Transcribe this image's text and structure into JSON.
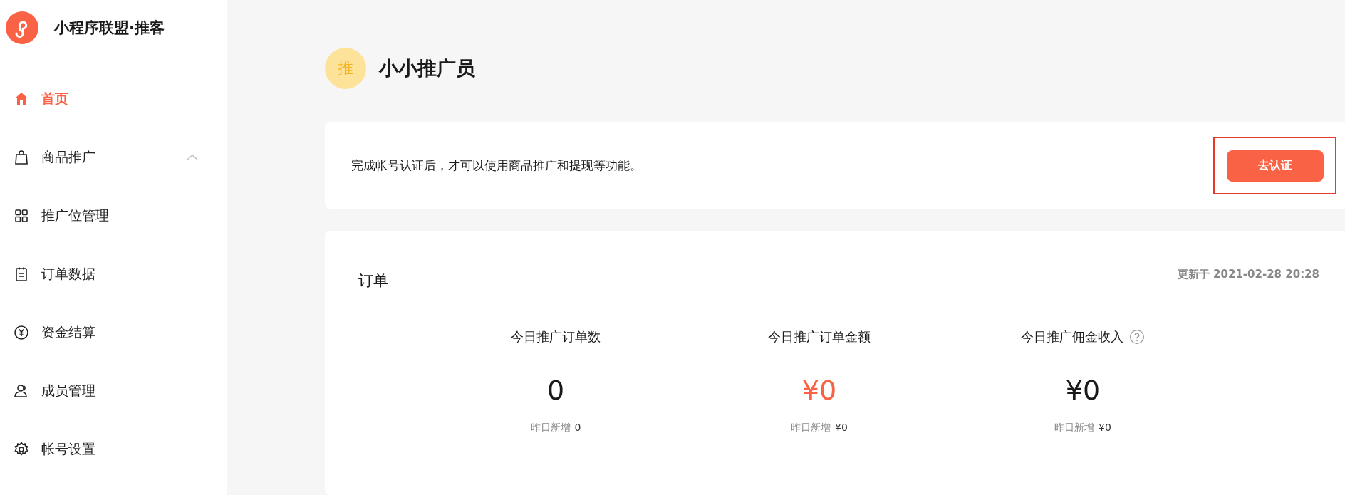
{
  "brand": {
    "title": "小程序联盟·推客"
  },
  "sidebar": {
    "items": [
      {
        "label": "首页",
        "selected": true
      },
      {
        "label": "商品推广",
        "selected": false,
        "expanded": true
      },
      {
        "label": "推广位管理",
        "selected": false
      },
      {
        "label": "订单数据",
        "selected": false
      },
      {
        "label": "资金结算",
        "selected": false
      },
      {
        "label": "成员管理",
        "selected": false
      },
      {
        "label": "帐号设置",
        "selected": false
      }
    ]
  },
  "profile": {
    "avatar_text": "推",
    "name": "小小推广员"
  },
  "notice": {
    "text": "完成帐号认证后，才可以使用商品推广和提现等功能。",
    "button": "去认证",
    "highlighted": true
  },
  "orders": {
    "title": "订单",
    "updated": "更新于 2021-02-28 20:28",
    "stats": [
      {
        "label": "今日推广订单数",
        "value": "0",
        "color": "#1a1a1a",
        "help": false,
        "yesterday_label": "昨日新增",
        "yesterday_value": "0"
      },
      {
        "label": "今日推广订单金额",
        "value": "¥0",
        "color": "#fa6246",
        "help": false,
        "yesterday_label": "昨日新增",
        "yesterday_value": "¥0"
      },
      {
        "label": "今日推广佣金收入",
        "value": "¥0",
        "color": "#1a1a1a",
        "help": true,
        "yesterday_label": "昨日新增",
        "yesterday_value": "¥0"
      }
    ]
  }
}
